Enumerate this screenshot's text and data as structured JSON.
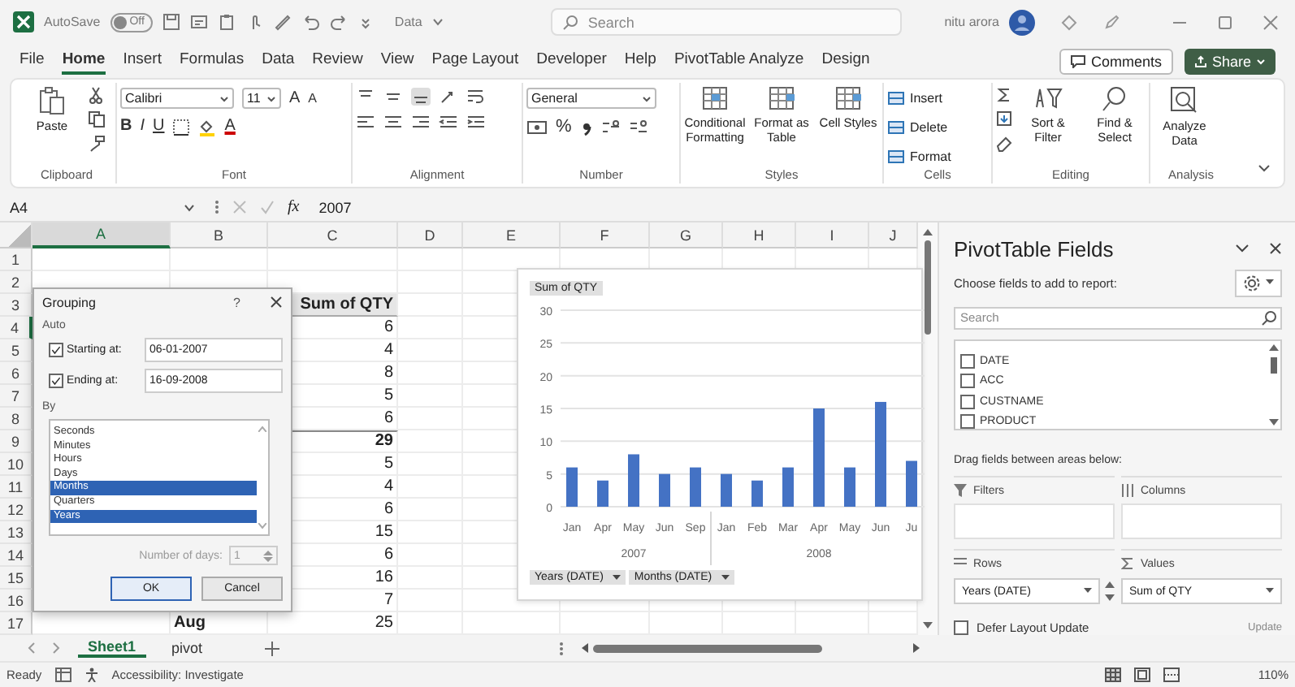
{
  "title_bar": {
    "autosave_label": "AutoSave",
    "autosave_toggle": {
      "label": "Off",
      "on": false
    },
    "file_name": "Data",
    "search_placeholder": "Search",
    "user_name": "nitu arora"
  },
  "menu_tabs": [
    {
      "label": "File",
      "selected": false
    },
    {
      "label": "Home",
      "selected": true
    },
    {
      "label": "Insert",
      "selected": false
    },
    {
      "label": "Formulas",
      "selected": false
    },
    {
      "label": "Data",
      "selected": false
    },
    {
      "label": "Review",
      "selected": false
    },
    {
      "label": "View",
      "selected": false
    },
    {
      "label": "Page Layout",
      "selected": false
    },
    {
      "label": "Developer",
      "selected": false
    },
    {
      "label": "Help",
      "selected": false
    },
    {
      "label": "PivotTable Analyze",
      "selected": false
    },
    {
      "label": "Design",
      "selected": false
    }
  ],
  "comments_button": "Comments",
  "share_button": "Share",
  "ribbon": {
    "clipboard": {
      "label": "Clipboard",
      "paste": "Paste"
    },
    "font": {
      "label": "Font",
      "family": "Calibri",
      "size": "11",
      "grow": "A",
      "shrink": "A",
      "bold": "B",
      "italic": "I",
      "underline": "U",
      "font_color_letter": "A"
    },
    "alignment": {
      "label": "Alignment"
    },
    "number": {
      "label": "Number",
      "format": "General",
      "percent": "%"
    },
    "styles": {
      "label": "Styles",
      "buttons": [
        "Conditional Formatting",
        "Format as Table",
        "Cell Styles"
      ]
    },
    "cells": {
      "label": "Cells",
      "buttons": [
        "Insert",
        "Delete",
        "Format"
      ]
    },
    "editing": {
      "label": "Editing",
      "buttons": [
        "Sort & Filter",
        "Find & Select"
      ]
    },
    "analysis": {
      "label": "Analysis",
      "buttons": [
        "Analyze Data"
      ]
    }
  },
  "formula_bar": {
    "name_box": "A4",
    "fx": "fx",
    "formula": "2007"
  },
  "sheet": {
    "columns": [
      {
        "label": "A",
        "selected": true
      },
      {
        "label": "B",
        "selected": false
      },
      {
        "label": "C",
        "selected": false
      },
      {
        "label": "D",
        "selected": false
      },
      {
        "label": "E",
        "selected": false
      },
      {
        "label": "F",
        "selected": false
      },
      {
        "label": "G",
        "selected": false
      },
      {
        "label": "H",
        "selected": false
      },
      {
        "label": "I",
        "selected": false
      },
      {
        "label": "J",
        "selected": false
      }
    ],
    "rows": [
      {
        "number": "1",
        "kind": "blank",
        "selected": false
      },
      {
        "number": "2",
        "kind": "blank",
        "selected": false
      },
      {
        "number": "3",
        "kind": "header",
        "selected": false,
        "c": "Sum of QTY"
      },
      {
        "number": "4",
        "kind": "value",
        "selected": true,
        "c": "6"
      },
      {
        "number": "5",
        "kind": "value",
        "selected": false,
        "c": "4"
      },
      {
        "number": "6",
        "kind": "value",
        "selected": false,
        "c": "8"
      },
      {
        "number": "7",
        "kind": "value",
        "selected": false,
        "c": "5"
      },
      {
        "number": "8",
        "kind": "value",
        "selected": false,
        "c": "6"
      },
      {
        "number": "9",
        "kind": "total",
        "selected": false,
        "c": "29"
      },
      {
        "number": "10",
        "kind": "value",
        "selected": false,
        "c": "5"
      },
      {
        "number": "11",
        "kind": "value",
        "selected": false,
        "c": "4"
      },
      {
        "number": "12",
        "kind": "value",
        "selected": false,
        "c": "6"
      },
      {
        "number": "13",
        "kind": "value",
        "selected": false,
        "c": "15"
      },
      {
        "number": "14",
        "kind": "value",
        "selected": false,
        "c": "6"
      },
      {
        "number": "15",
        "kind": "value",
        "selected": false,
        "c": "16"
      },
      {
        "number": "16",
        "kind": "value",
        "selected": false,
        "c": "7"
      },
      {
        "number": "17",
        "kind": "value",
        "selected": false,
        "b": "Aug",
        "c": "25"
      }
    ]
  },
  "grouping_dialog": {
    "title": "Grouping",
    "help": "?",
    "auto_label": "Auto",
    "starting": {
      "label": "Starting at:",
      "checked": true,
      "value": "06-01-2007"
    },
    "ending": {
      "label": "Ending at:",
      "checked": true,
      "value": "16-09-2008"
    },
    "by_label": "By",
    "by_items": [
      {
        "label": "Seconds",
        "selected": false
      },
      {
        "label": "Minutes",
        "selected": false
      },
      {
        "label": "Hours",
        "selected": false
      },
      {
        "label": "Days",
        "selected": false
      },
      {
        "label": "Months",
        "selected": true
      },
      {
        "label": "Quarters",
        "selected": false
      },
      {
        "label": "Years",
        "selected": true
      }
    ],
    "days_label": "Number of days:",
    "days_value": "1",
    "ok": "OK",
    "cancel": "Cancel"
  },
  "chart": {
    "field_buttons": [
      "Years (DATE)",
      "Months (DATE)"
    ],
    "chart_data": {
      "type": "bar",
      "categories": [
        "Jan",
        "Apr",
        "May",
        "Jun",
        "Sep",
        "Jan",
        "Feb",
        "Mar",
        "Apr",
        "May",
        "Jun",
        "Ju"
      ],
      "series": [
        {
          "name": "Sum of QTY",
          "color": "#4472c4",
          "values": [
            6,
            4,
            8,
            5,
            6,
            5,
            4,
            6,
            15,
            6,
            16,
            7
          ]
        }
      ],
      "ylim": [
        0,
        30
      ],
      "yticks": [
        0,
        5,
        10,
        15,
        20,
        25,
        30
      ],
      "grid": true
    },
    "year_groups": [
      {
        "label": "2007"
      },
      {
        "label": "2008"
      }
    ]
  },
  "pivot_panel": {
    "title": "PivotTable Fields",
    "subtitle": "Choose fields to add to report:",
    "search_placeholder": "Search",
    "fields": [
      {
        "label": "DATE",
        "checked": false
      },
      {
        "label": "ACC",
        "checked": false
      },
      {
        "label": "CUSTNAME",
        "checked": false
      },
      {
        "label": "PRODUCT",
        "checked": false
      }
    ],
    "drag_hint": "Drag fields between areas below:",
    "areas": [
      {
        "label": "Filters"
      },
      {
        "label": "Columns"
      },
      {
        "label": "Rows",
        "field": "Years (DATE)"
      },
      {
        "label": "Values",
        "field": "Sum of QTY"
      }
    ],
    "defer": {
      "label": "Defer Layout Update",
      "checked": false
    },
    "update": "Update"
  },
  "sheet_tabs": [
    {
      "label": "Sheet1",
      "selected": true
    },
    {
      "label": "pivot",
      "selected": false
    }
  ],
  "status_bar": {
    "ready": "Ready",
    "accessibility": "Accessibility: Investigate",
    "zoom": "110%"
  }
}
